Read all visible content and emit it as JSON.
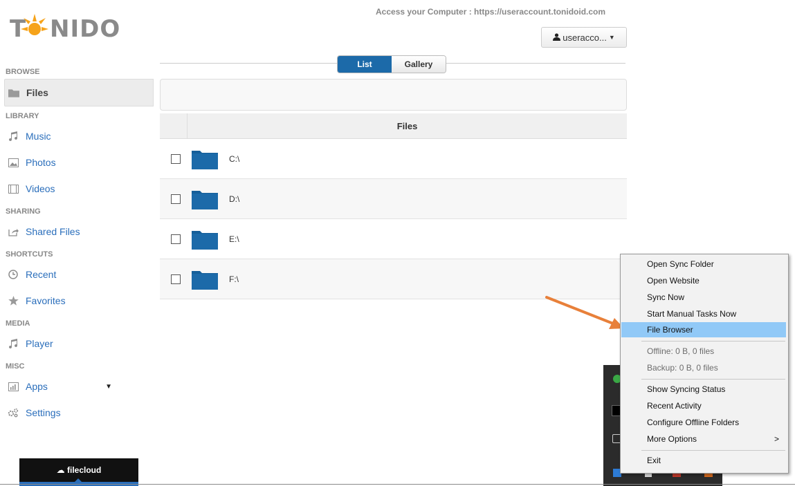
{
  "logo": {
    "text": "NIDO",
    "first_letter": "T"
  },
  "header": {
    "access_text": "Access your Computer : https://useraccount.tonidoid.com",
    "user_label": "useracco...",
    "user_icon": "user-icon",
    "caret_icon": "caret-down-icon"
  },
  "view_toggle": {
    "list": "List",
    "gallery": "Gallery"
  },
  "sidebar": {
    "sections": [
      {
        "title": "BROWSE",
        "items": [
          {
            "label": "Files",
            "icon": "folder-icon",
            "active": true
          }
        ]
      },
      {
        "title": "LIBRARY",
        "items": [
          {
            "label": "Music",
            "icon": "music-icon"
          },
          {
            "label": "Photos",
            "icon": "image-icon"
          },
          {
            "label": "Videos",
            "icon": "film-icon"
          }
        ]
      },
      {
        "title": "SHARING",
        "items": [
          {
            "label": "Shared Files",
            "icon": "share-icon"
          }
        ]
      },
      {
        "title": "SHORTCUTS",
        "items": [
          {
            "label": "Recent",
            "icon": "clock-icon"
          },
          {
            "label": "Favorites",
            "icon": "star-icon"
          }
        ]
      },
      {
        "title": "MEDIA",
        "items": [
          {
            "label": "Player",
            "icon": "music-icon"
          }
        ]
      },
      {
        "title": "MISC",
        "items": [
          {
            "label": "Apps",
            "icon": "chart-icon"
          },
          {
            "label": "Settings",
            "icon": "gears-icon"
          }
        ]
      }
    ]
  },
  "filecloud": {
    "label": "filecloud"
  },
  "table": {
    "header": "Files",
    "rows": [
      {
        "name": "C:\\"
      },
      {
        "name": "D:\\"
      },
      {
        "name": "E:\\"
      },
      {
        "name": "F:\\"
      }
    ]
  },
  "context_menu": {
    "items": [
      "Open Sync Folder",
      "Open Website",
      "Sync Now",
      "Start Manual Tasks Now",
      "File Browser",
      "Offline: 0 B, 0 files",
      "Backup: 0 B, 0 files",
      "Show Syncing Status",
      "Recent Activity",
      "Configure Offline Folders",
      "More Options",
      "Exit"
    ],
    "submenu_arrow": ">"
  },
  "colors": {
    "accent": "#1c6aa9",
    "link": "#2a6ebb",
    "highlight": "#91c9f7",
    "arrow": "#e8803a"
  }
}
